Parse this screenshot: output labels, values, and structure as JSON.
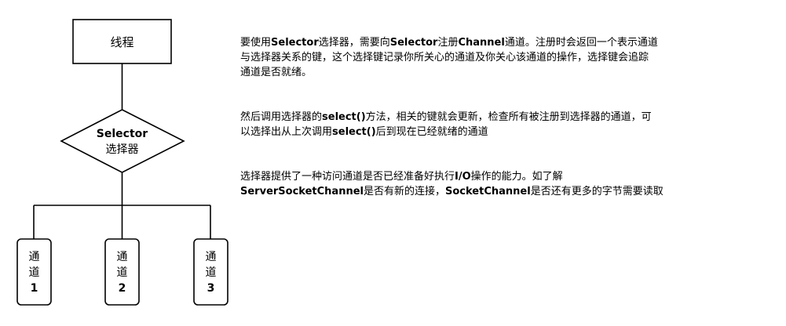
{
  "diagram": {
    "thread_label": "线程",
    "selector_label_en": "Selector",
    "selector_label_zh": "选择器",
    "channels": [
      {
        "lines": [
          "通",
          "道",
          "1"
        ]
      },
      {
        "lines": [
          "通",
          "道",
          "2"
        ]
      },
      {
        "lines": [
          "通",
          "道",
          "3"
        ]
      }
    ]
  },
  "description": {
    "paragraphs": [
      [
        {
          "text": "要使用",
          "bold": false
        },
        {
          "text": "Selector",
          "bold": true
        },
        {
          "text": "选择器，需要向",
          "bold": false
        },
        {
          "text": "Selector",
          "bold": true
        },
        {
          "text": "注册",
          "bold": false
        },
        {
          "text": "Channel",
          "bold": true
        },
        {
          "text": "通道。注册时会返回一个表示通道\n与选择器关系的键，这个选择键记录你所关心的通道及你关心该通道的操作，选择键会追踪\n通道是否就绪。",
          "bold": false
        }
      ],
      [
        {
          "text": "然后调用选择器的",
          "bold": false
        },
        {
          "text": "select()",
          "bold": true
        },
        {
          "text": "方法，相关的键就会更新，检查所有被注册到选择器的通道，可\n以选择出从上次调用",
          "bold": false
        },
        {
          "text": "select()",
          "bold": true
        },
        {
          "text": "后到现在已经就绪的通道",
          "bold": false
        }
      ],
      [
        {
          "text": "选择器提供了一种访问通道是否已经准备好执行",
          "bold": false
        },
        {
          "text": "I/O",
          "bold": true
        },
        {
          "text": "操作的能力。如了解\n",
          "bold": false
        },
        {
          "text": "ServerSocketChannel",
          "bold": true
        },
        {
          "text": "是否有新的连接，",
          "bold": false
        },
        {
          "text": "SocketChannel",
          "bold": true
        },
        {
          "text": "是否还有更多的字节需要读取",
          "bold": false
        }
      ]
    ]
  }
}
